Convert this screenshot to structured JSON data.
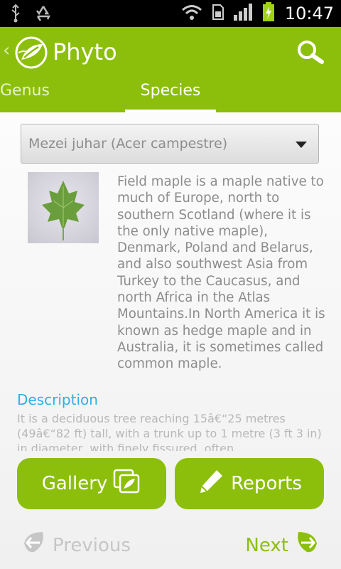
{
  "status_bar": {
    "time": "10:47",
    "icons": [
      "usb-icon",
      "recycle-icon",
      "wifi-icon",
      "sim-icon",
      "signal-icon",
      "battery-charging-icon"
    ]
  },
  "app": {
    "title": "Phyto",
    "back_glyph": "‹",
    "brand_color": "#8cbf0b"
  },
  "tabs": [
    {
      "label": "Genus",
      "selected": false
    },
    {
      "label": "Species",
      "selected": true
    }
  ],
  "species_select": {
    "value": "Mezei juhar (Acer campestre)"
  },
  "summary": "Field maple is a maple native to much of Europe, north to southern Scotland (where it is the only native maple), Denmark, Poland and Belarus, and also southwest Asia from Turkey to the Caucasus, and north Africa in the Atlas Mountains.In North America it is known as hedge maple and in Australia, it is sometimes called common maple.",
  "description": {
    "heading": "Description",
    "body": "It is a deciduous tree reaching 15â€“25 metres (49â€“82 ft) tall, with a trunk up to 1 metre (3 ft 3 in) in diameter, with finely fissured, often"
  },
  "buttons": {
    "gallery": "Gallery",
    "reports": "Reports"
  },
  "nav": {
    "previous": "Previous",
    "next": "Next"
  }
}
